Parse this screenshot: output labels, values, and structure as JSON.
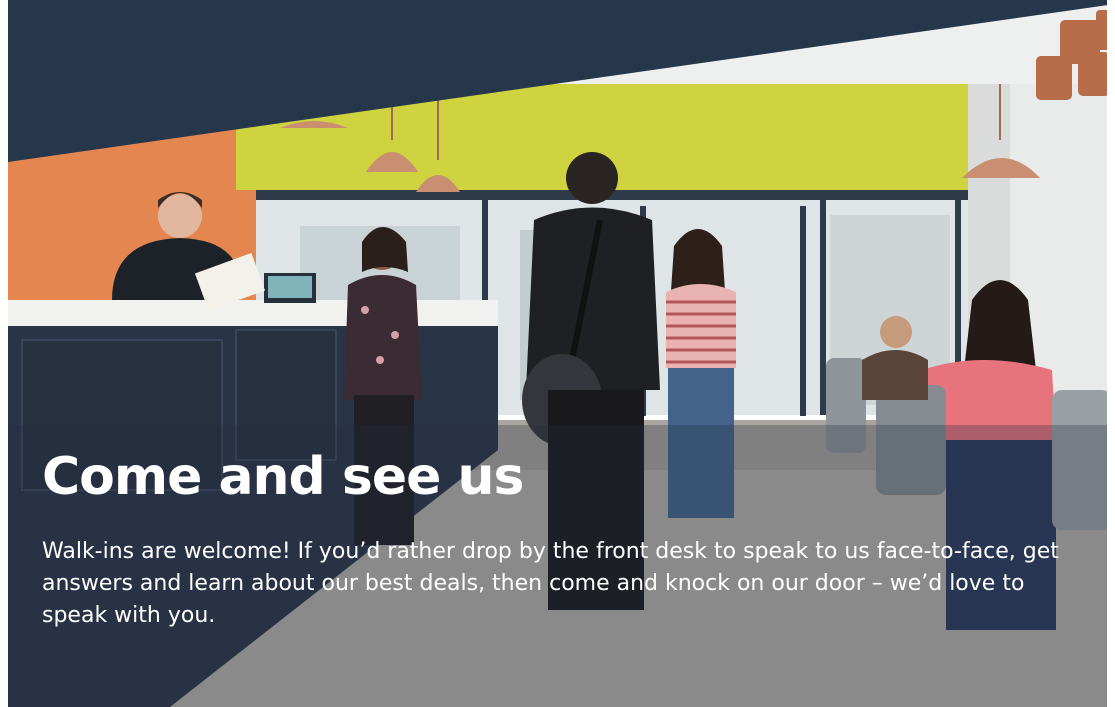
{
  "hero": {
    "title": "Come and see us",
    "body": "Walk-ins are welcome! If you’d rather drop by the front desk to speak to us face-to-face, get answers and learn about our best deals, then come and knock on our door – we’d love to speak with you."
  },
  "colors": {
    "banner_navy": "#26374c",
    "accent_yellow": "#cfd33d",
    "accent_orange": "#e8864f",
    "desk_navy": "#2a3447",
    "text": "#ffffff"
  },
  "photo": {
    "description_icon": "reception-photo"
  }
}
